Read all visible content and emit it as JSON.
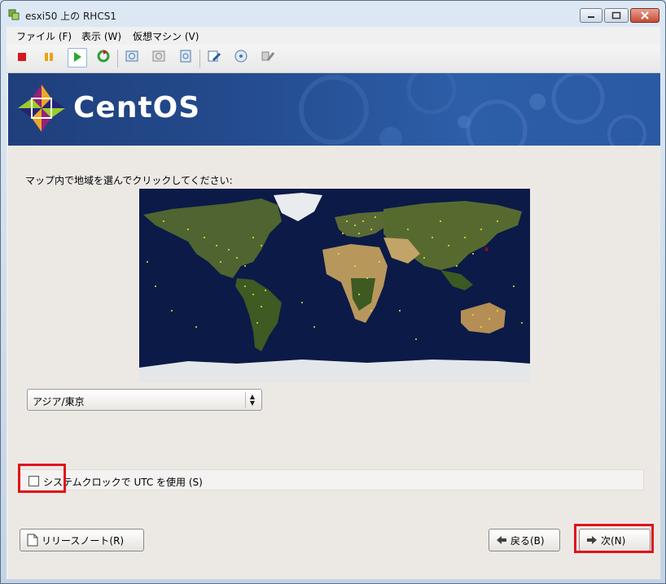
{
  "window": {
    "title": "esxi50 上の RHCS1"
  },
  "menu": [
    {
      "label": "ファイル (F)"
    },
    {
      "label": "表示 (W)"
    },
    {
      "label": "仮想マシン (V)"
    }
  ],
  "banner": {
    "brand": "CentOS"
  },
  "timezone": {
    "prompt": "マップ内で地域を選んでクリックしてください:",
    "selected": "アジア/東京",
    "utc_label": "システムクロックで UTC を使用 (S)",
    "utc_checked": false
  },
  "buttons": {
    "release_notes": "リリースノート(R)",
    "back": "戻る(B)",
    "next": "次(N)"
  },
  "colors": {
    "highlight": "#e0141b",
    "banner": "#244b8e"
  }
}
